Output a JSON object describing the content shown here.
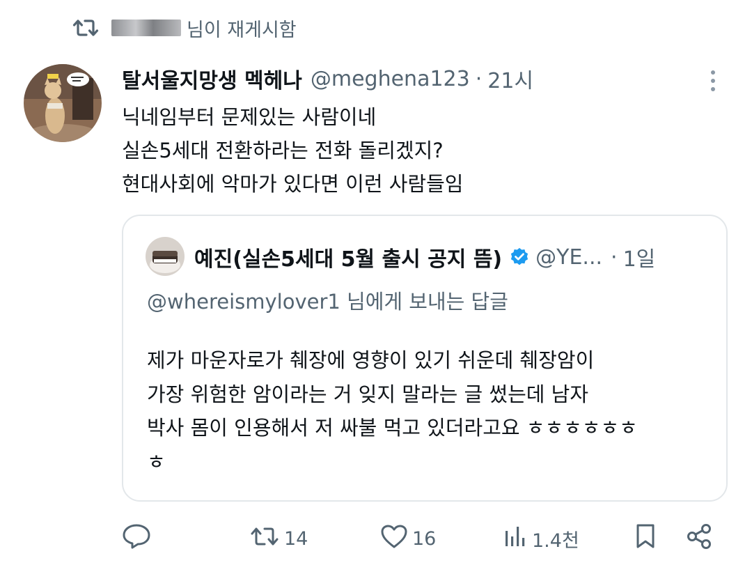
{
  "repost": {
    "label": "님이 재게시함",
    "icon": "repost-icon"
  },
  "tweet": {
    "display_name": "탈서울지망생 멕헤나",
    "handle": "@meghena123",
    "separator": "·",
    "time": "21시",
    "avatar_icon": "avatar-cat",
    "more_icon": "more-icon",
    "text_lines": [
      "닉네임부터 문제있는 사람이네",
      "실손5세대 전환하라는 전화 돌리겠지?",
      "현대사회에 악마가 있다면 이런 사람들임"
    ]
  },
  "quote": {
    "display_name": "예진(실손5세대 5월 출시 공지 뜸)",
    "handle": "@YE...",
    "separator": "·",
    "time": "1일",
    "verified_icon": "verified-badge-icon",
    "verified_color": "#1d9bf0",
    "replying_to": "@whereismylover1 님에게 보내는 답글",
    "text_lines": [
      "제가 마운자로가 췌장에 영향이 있기 쉬운데 췌장암이",
      "가장 위험한 암이라는 거 잊지 말라는 글 썼는데 남자",
      "박사 몸이 인용해서 저 싸불 먹고 있더라고요 ㅎㅎㅎㅎㅎㅎ",
      "ㅎ"
    ]
  },
  "actions": {
    "reply": {
      "icon": "reply-icon",
      "count": ""
    },
    "retweet": {
      "icon": "retweet-icon",
      "count": "14"
    },
    "like": {
      "icon": "heart-icon",
      "count": "16"
    },
    "views": {
      "icon": "views-icon",
      "count": "1.4천"
    },
    "bookmark": {
      "icon": "bookmark-icon"
    },
    "share": {
      "icon": "share-icon"
    }
  },
  "colors": {
    "primary_text": "#0f1419",
    "secondary_text": "#536471",
    "border": "#e3e7ea"
  }
}
